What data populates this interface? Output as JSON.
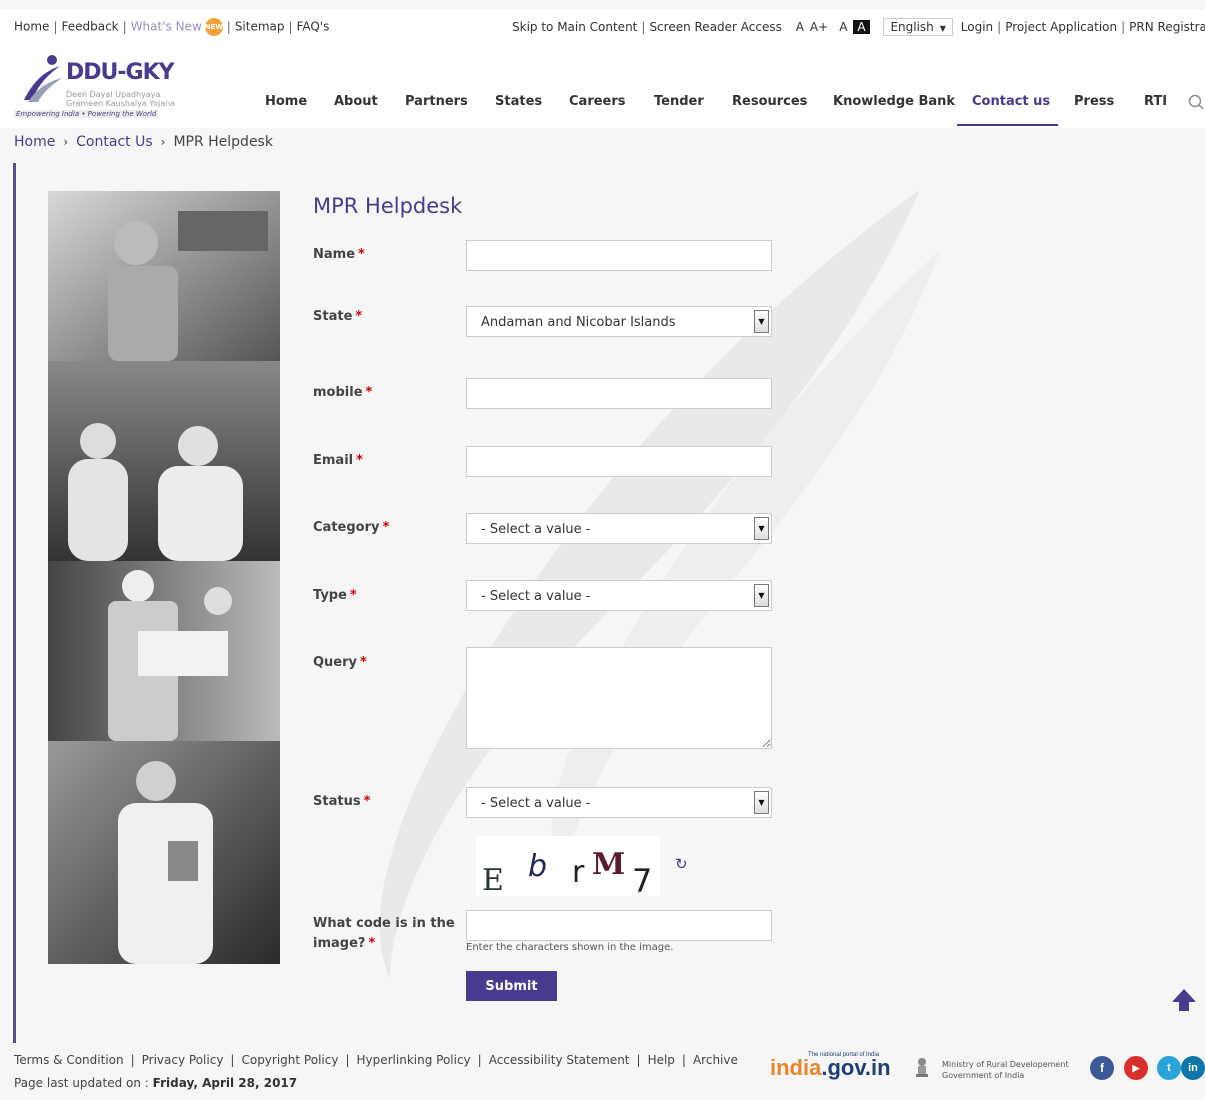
{
  "topbar": {
    "links_left": [
      "Home",
      "Feedback"
    ],
    "whats_new": "What's New",
    "badge": "NEW",
    "links_left2": [
      "Sitemap",
      "FAQ's"
    ],
    "skip": "Skip to Main Content",
    "screen_reader": "Screen Reader Access",
    "font_small": "A",
    "font_large": "A+",
    "font_normal": "A",
    "font_contrast": "A",
    "language": "English",
    "login": "Login",
    "project_application": "Project Application",
    "prn_registration": "PRN Registration"
  },
  "logo": {
    "name": "DDU-GKY",
    "line1": "Deen Dayal Upadhyaya",
    "line2": "Grameen Kaushalya Yojana",
    "tagline": "Empowering India • Powering the World"
  },
  "nav": {
    "items": [
      "Home",
      "About",
      "Partners",
      "States",
      "Careers",
      "Tender",
      "Resources",
      "Knowledge Bank",
      "Contact us",
      "Press",
      "RTI"
    ],
    "active": "Contact us"
  },
  "breadcrumb": {
    "home": "Home",
    "contact": "Contact Us",
    "current": "MPR Helpdesk"
  },
  "form": {
    "title": "MPR Helpdesk",
    "name_label": "Name",
    "state_label": "State",
    "state_value": "Andaman and Nicobar Islands",
    "mobile_label": "mobile",
    "email_label": "Email",
    "category_label": "Category",
    "category_value": "- Select a value -",
    "type_label": "Type",
    "type_value": "- Select a value -",
    "query_label": "Query",
    "status_label": "Status",
    "status_value": "- Select a value -",
    "captcha_chars": [
      "E",
      "b",
      "r",
      "M",
      "7"
    ],
    "captcha_label_1": "What code is in the",
    "captcha_label_2": "image?",
    "captcha_hint": "Enter the characters shown in the image.",
    "submit": "Submit",
    "required_mark": "*"
  },
  "footer": {
    "links": [
      "Terms & Condition",
      "Privacy Policy",
      "Copyright Policy",
      "Hyperlinking Policy",
      "Accessibility Statement",
      "Help",
      "Archive"
    ],
    "updated_label": "Page last updated on :",
    "updated_date": "Friday, April 28, 2017",
    "portal_in": "india",
    "portal_rest": ".gov.in",
    "portal_tag": "The national portal of India",
    "ministry_1": "Ministry of Rural Developement",
    "ministry_2": "Government of India",
    "social_icons": [
      "facebook-icon",
      "youtube-icon",
      "twitter-icon",
      "linkedin-icon"
    ]
  },
  "colors": {
    "brand": "#4a3a8f",
    "required": "#cc0000"
  }
}
